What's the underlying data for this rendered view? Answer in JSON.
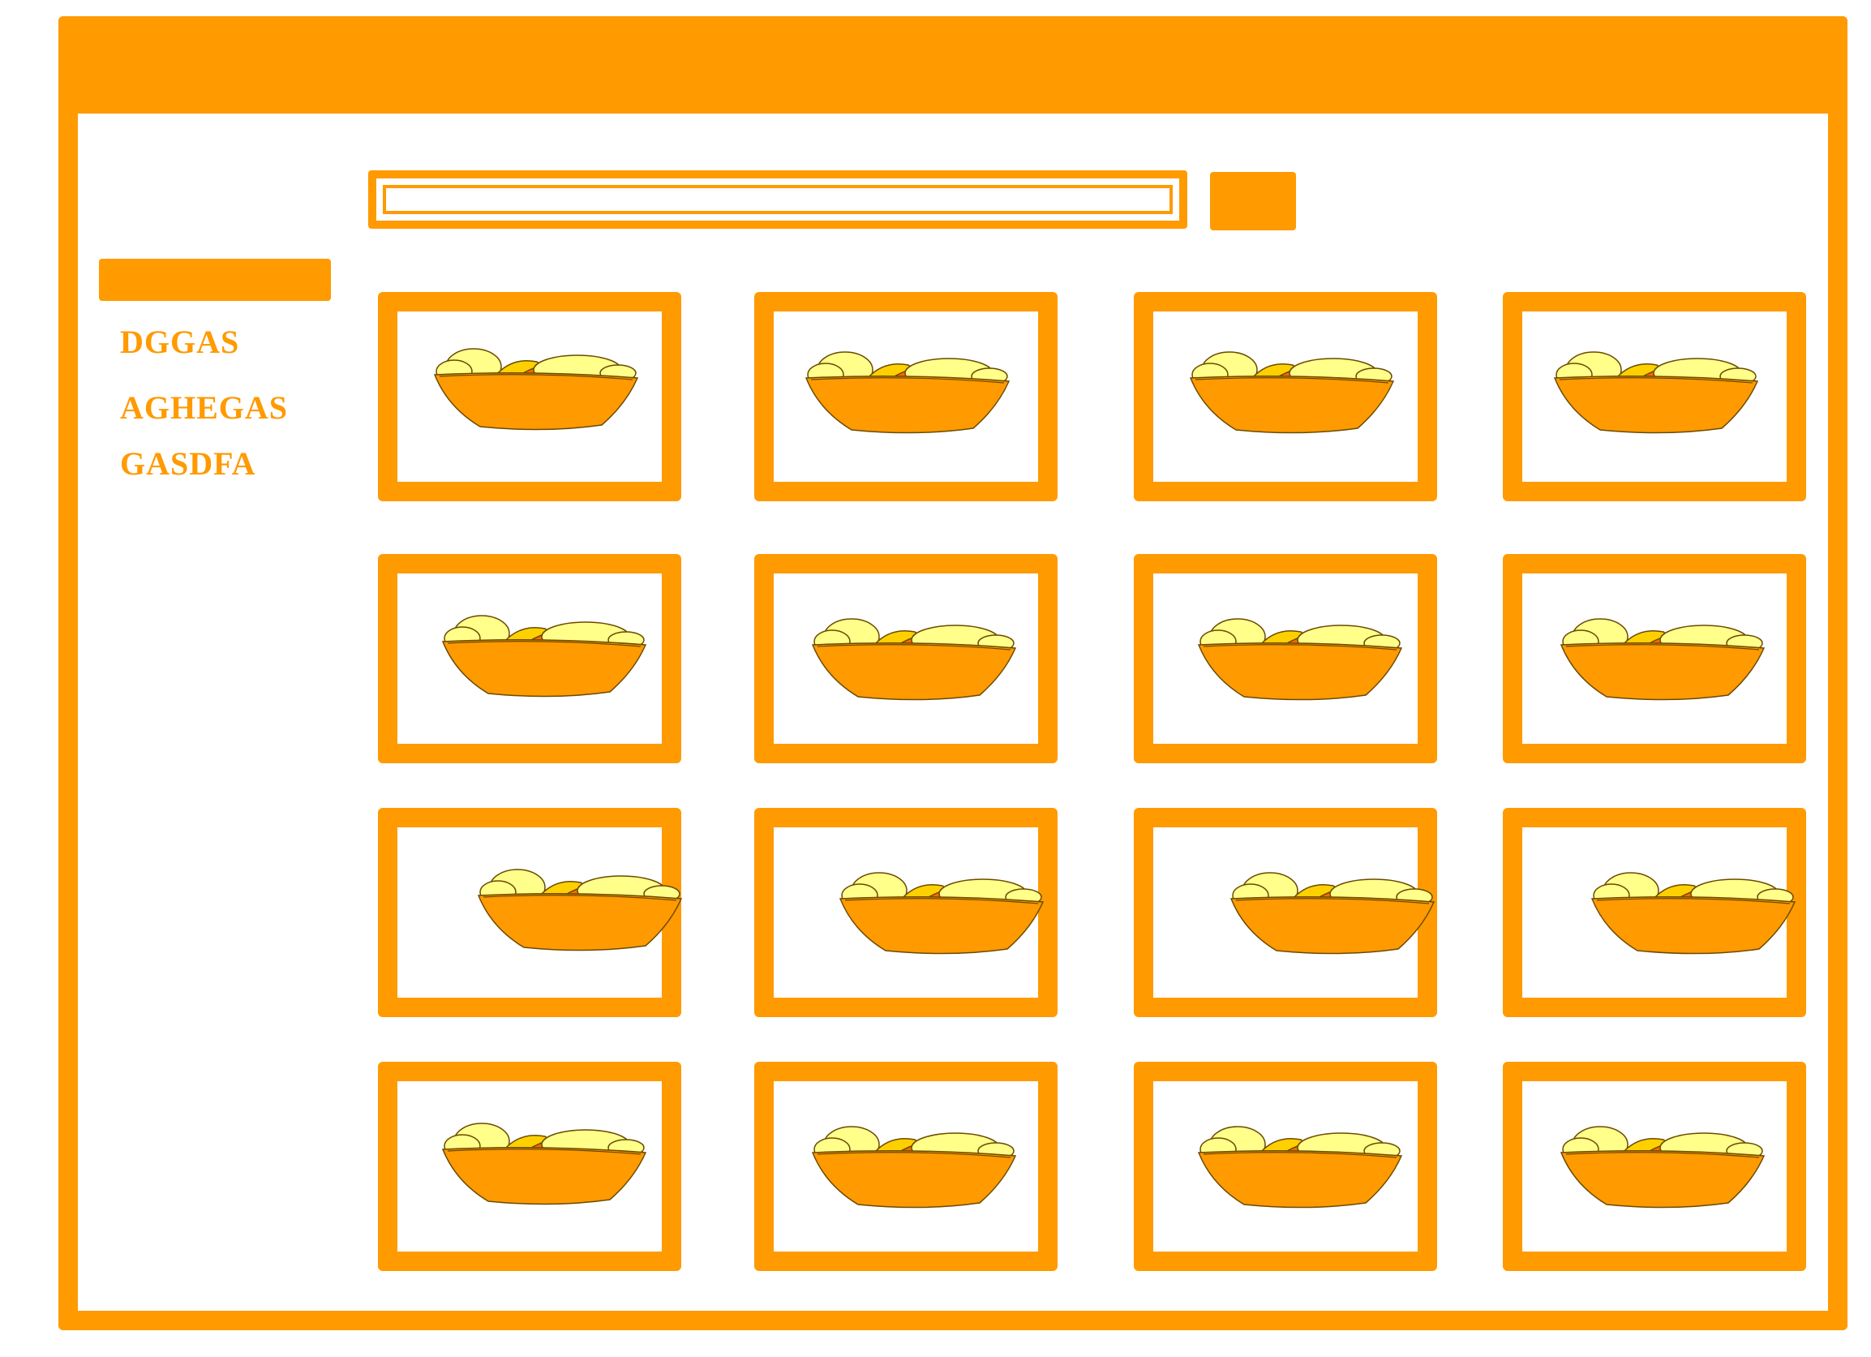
{
  "colors": {
    "accent": "#FF9A00",
    "bowl": "#FF9A00",
    "fruit_light": "#FFFF8A",
    "fruit_mid": "#FFD000",
    "fruit_dark": "#FF6A00"
  },
  "sidebar": {
    "items": [
      {
        "label": "DGGAS"
      },
      {
        "label": "AGHEGAS"
      },
      {
        "label": "GASDFA"
      }
    ]
  },
  "search": {
    "value": "",
    "placeholder": ""
  },
  "gallery": {
    "columns": 4,
    "rows": 4,
    "item_icon": "fruit-bowl-icon",
    "item_count": 16
  }
}
